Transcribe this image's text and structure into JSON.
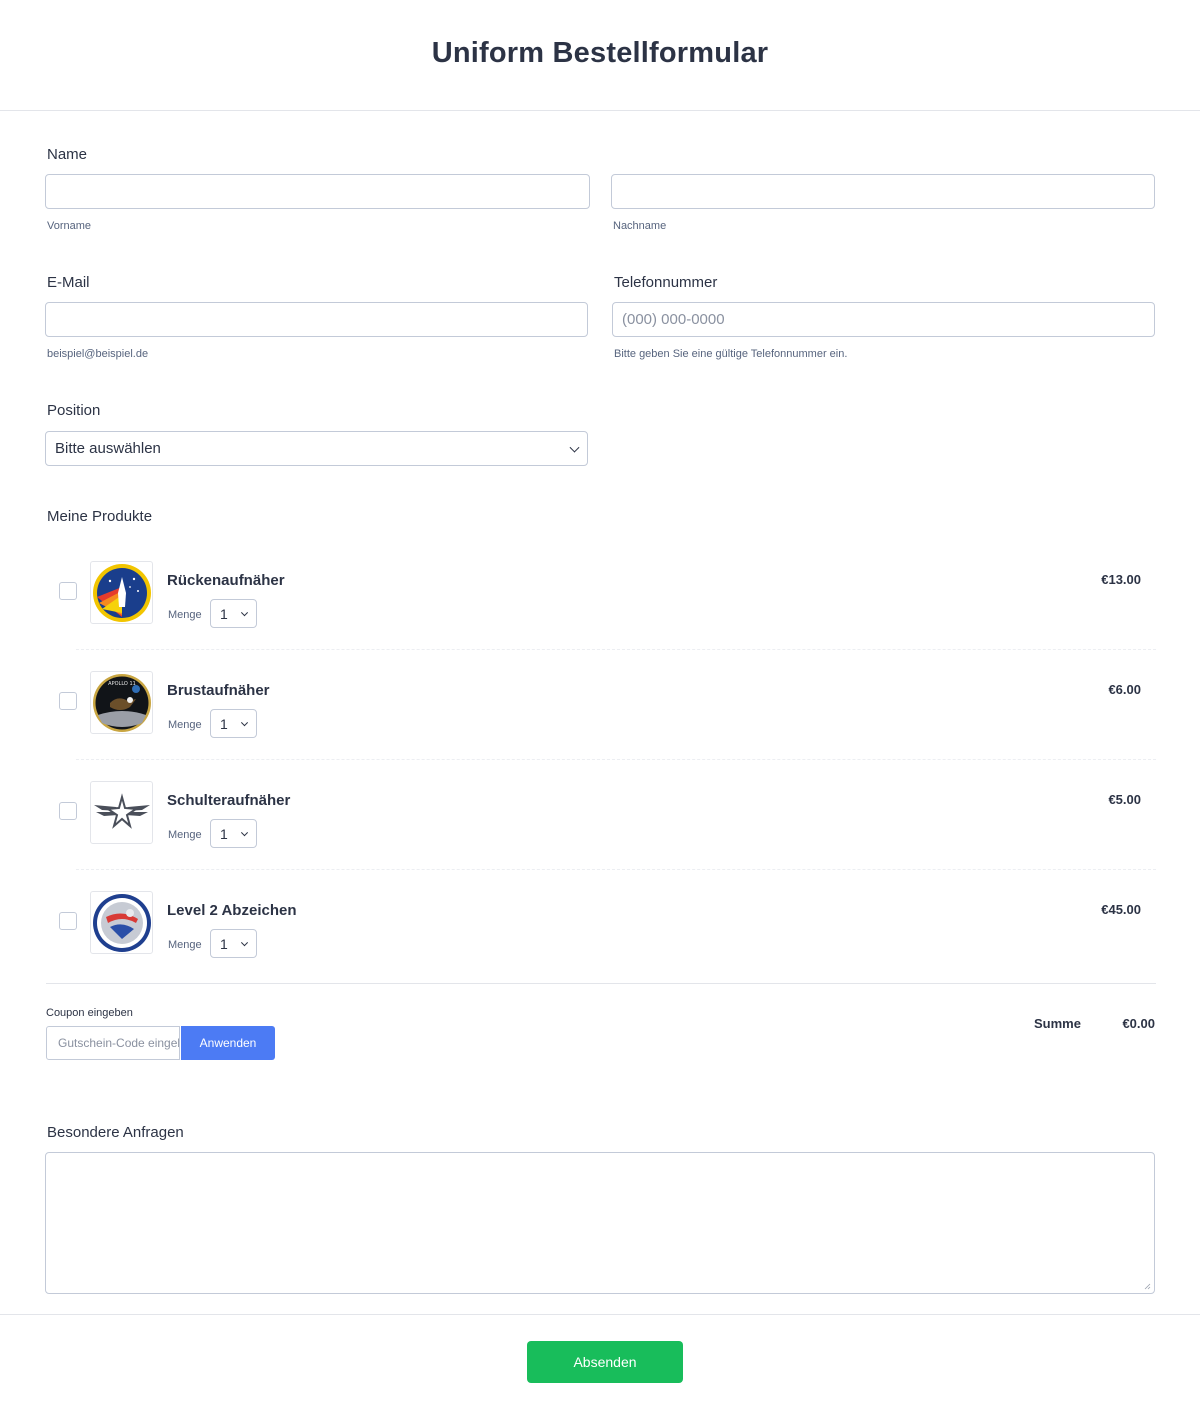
{
  "form": {
    "title": "Uniform Bestellformular"
  },
  "name": {
    "label": "Name",
    "first_value": "",
    "first_sublabel": "Vorname",
    "last_value": "",
    "last_sublabel": "Nachname"
  },
  "email": {
    "label": "E-Mail",
    "value": "",
    "sublabel": "beispiel@beispiel.de"
  },
  "phone": {
    "label": "Telefonnummer",
    "placeholder": "(000) 000-0000",
    "sublabel": "Bitte geben Sie eine gültige Telefonnummer ein."
  },
  "position": {
    "label": "Position",
    "selected": "Bitte auswählen"
  },
  "products": {
    "label": "Meine Produkte",
    "quantity_label": "Menge",
    "items": [
      {
        "name": "Rückenaufnäher",
        "price": "€13.00",
        "quantity": "1",
        "checked": false,
        "image_icon": "shuttle-patch-icon"
      },
      {
        "name": "Brustaufnäher",
        "price": "€6.00",
        "quantity": "1",
        "checked": false,
        "image_icon": "apollo-11-patch-icon"
      },
      {
        "name": "Schulteraufnäher",
        "price": "€5.00",
        "quantity": "1",
        "checked": false,
        "image_icon": "winged-star-patch-icon"
      },
      {
        "name": "Level 2 Abzeichen",
        "price": "€45.00",
        "quantity": "1",
        "checked": false,
        "image_icon": "mission-badge-icon"
      }
    ]
  },
  "coupon": {
    "label": "Coupon eingeben",
    "placeholder": "Gutschein-Code eingeben",
    "button": "Anwenden"
  },
  "total": {
    "label": "Summe",
    "value": "€0.00"
  },
  "requests": {
    "label": "Besondere Anfragen",
    "value": ""
  },
  "submit": {
    "label": "Absenden"
  },
  "colors": {
    "accent": "#4c7bf4",
    "submit": "#18bd5b",
    "text": "#2c3345",
    "border": "#c3cad8"
  }
}
